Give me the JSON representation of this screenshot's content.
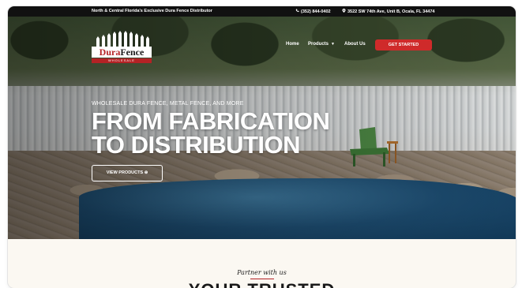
{
  "topbar": {
    "tagline": "North & Central Florida's Exclusive Dura Fence Distributor",
    "phone": "(352) 844-0402",
    "address": "3522 SW 74th Ave, Unit B, Ocala, FL 34474"
  },
  "logo": {
    "word_dura": "Dura",
    "word_fence": "Fence",
    "subtitle": "WHOLESALE"
  },
  "nav": {
    "home": "Home",
    "products": "Products",
    "about": "About Us",
    "cta": "GET STARTED"
  },
  "hero": {
    "eyebrow": "WHOLESALE DURA FENCE, METAL FENCE, AND MORE",
    "headline_line1": "FROM FABRICATION",
    "headline_line2": "TO DISTRIBUTION",
    "button": "VIEW PRODUCTS"
  },
  "partner": {
    "label": "Partner with us",
    "heading_partial": "YOUR TRUSTED"
  },
  "colors": {
    "accent_red": "#cf2a2a",
    "topbar_bg": "#111111",
    "cream_bg": "#fbf8f2"
  },
  "icons": [
    "phone-icon",
    "location-pin-icon",
    "chevron-down-icon",
    "arrow-circle-right-icon"
  ]
}
